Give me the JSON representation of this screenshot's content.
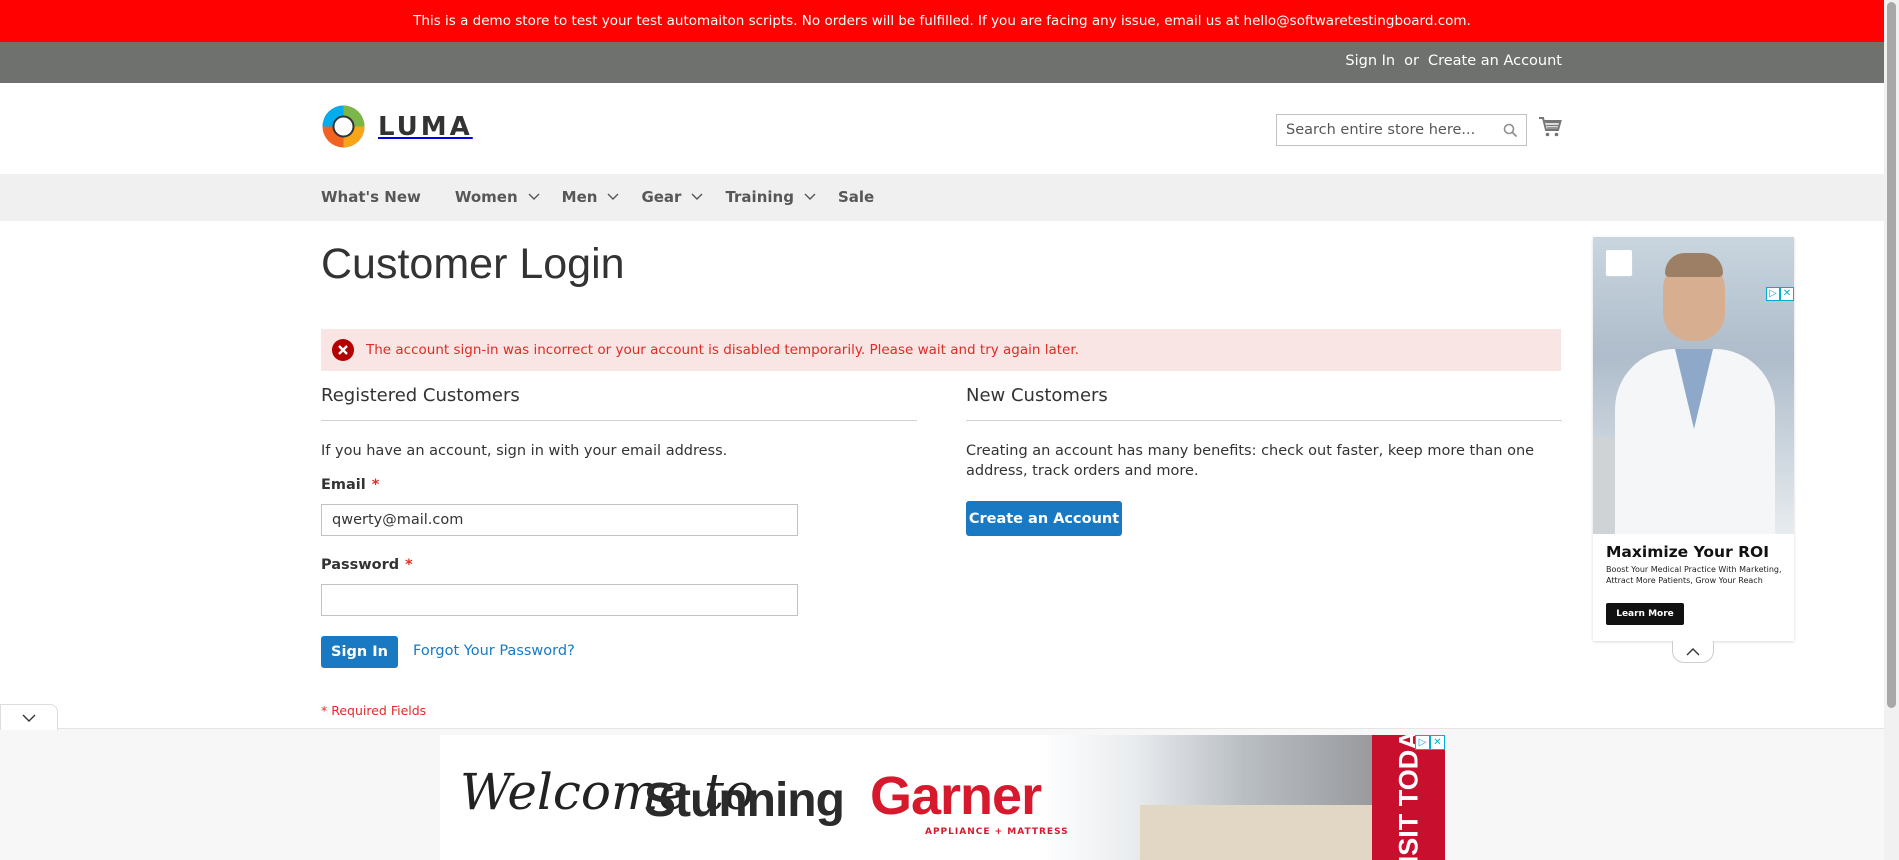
{
  "demo_notice": "This is a demo store to test your test automaiton scripts. No orders will be fulfilled. If you are facing any issue, email us at hello@softwaretestingboard.com.",
  "top_links": {
    "sign_in": "Sign In",
    "or": "or",
    "create_account": "Create an Account"
  },
  "logo": {
    "text": "LUMA",
    "icon": "luma-logo-icon"
  },
  "search": {
    "placeholder": "Search entire store here...",
    "icon": "search-icon"
  },
  "cart": {
    "icon": "cart-icon"
  },
  "nav": {
    "items": [
      {
        "label": "What's New",
        "has_dropdown": false
      },
      {
        "label": "Women",
        "has_dropdown": true
      },
      {
        "label": "Men",
        "has_dropdown": true
      },
      {
        "label": "Gear",
        "has_dropdown": true
      },
      {
        "label": "Training",
        "has_dropdown": true
      },
      {
        "label": "Sale",
        "has_dropdown": false
      }
    ]
  },
  "page_title": "Customer Login",
  "error_message": "The account sign-in was incorrect or your account is disabled temporarily. Please wait and try again later.",
  "registered": {
    "title": "Registered Customers",
    "intro": "If you have an account, sign in with your email address.",
    "email_label": "Email",
    "email_value": "qwerty@mail.com",
    "password_label": "Password",
    "password_value": "",
    "required_marker": "*",
    "sign_in_button": "Sign In",
    "forgot_link": "Forgot Your Password?",
    "required_note": "* Required Fields"
  },
  "new_customers": {
    "title": "New Customers",
    "text": "Creating an account has many benefits: check out faster, keep more than one address, track orders and more.",
    "create_button": "Create an Account"
  },
  "side_ad": {
    "title": "Maximize Your ROI",
    "subtitle": "Boost Your Medical Practice With Marketing, Attract More Patients, Grow Your Reach",
    "button": "Learn More"
  },
  "bottom_ad": {
    "welcome": "Welcome to",
    "stunning": "Stunning",
    "brand": "Garner",
    "tagline": "APPLIANCE + MATTRESS",
    "visit": "VISIT TODAY"
  },
  "colors": {
    "demo_bar": "#ff0101",
    "top_links_bar": "#6e716e",
    "primary_button": "#1979c3",
    "error_bg": "#fae5e5",
    "error_text": "#e02b27"
  }
}
